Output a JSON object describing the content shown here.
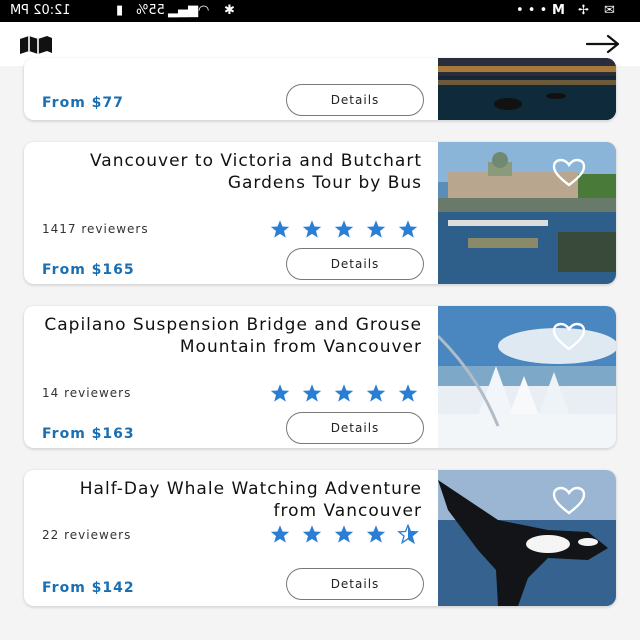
{
  "status_bar": {
    "time": "12:02 PM",
    "battery": "55%",
    "icons": [
      "more-dots-icon",
      "gmail-icon",
      "fan-icon",
      "mail-icon",
      "bluetooth-icon",
      "wifi-icon",
      "signal-icon",
      "battery-icon"
    ]
  },
  "toolbar": {
    "left_icon": "arrow-right-icon",
    "right_icon": "map-icon"
  },
  "tours": [
    {
      "title": "",
      "price": "From $77",
      "details_label": "Details",
      "reviews": "",
      "rating": null,
      "image": "night harbour photo"
    },
    {
      "title": "Vancouver to Victoria and Butchart Gardens Tour by Bus",
      "reviews": "1417 reviewers",
      "rating": 5,
      "price": "From $165",
      "details_label": "Details",
      "image": "victoria-harbour-photo"
    },
    {
      "title": "Capilano Suspension Bridge and Grouse Mountain from Vancouver",
      "reviews": "14 reviewers",
      "rating": 5,
      "price": "From $163",
      "details_label": "Details",
      "image": "snowy-mountain-photo"
    },
    {
      "title": "Half-Day Whale Watching Adventure from Vancouver",
      "reviews": "22 reviewers",
      "rating": 4.5,
      "price": "From $142",
      "details_label": "Details",
      "image": "orca-whale-photo"
    }
  ],
  "colors": {
    "price": "#1a6fb3",
    "star": "#2a7fd4",
    "status_bar": "#000000"
  }
}
